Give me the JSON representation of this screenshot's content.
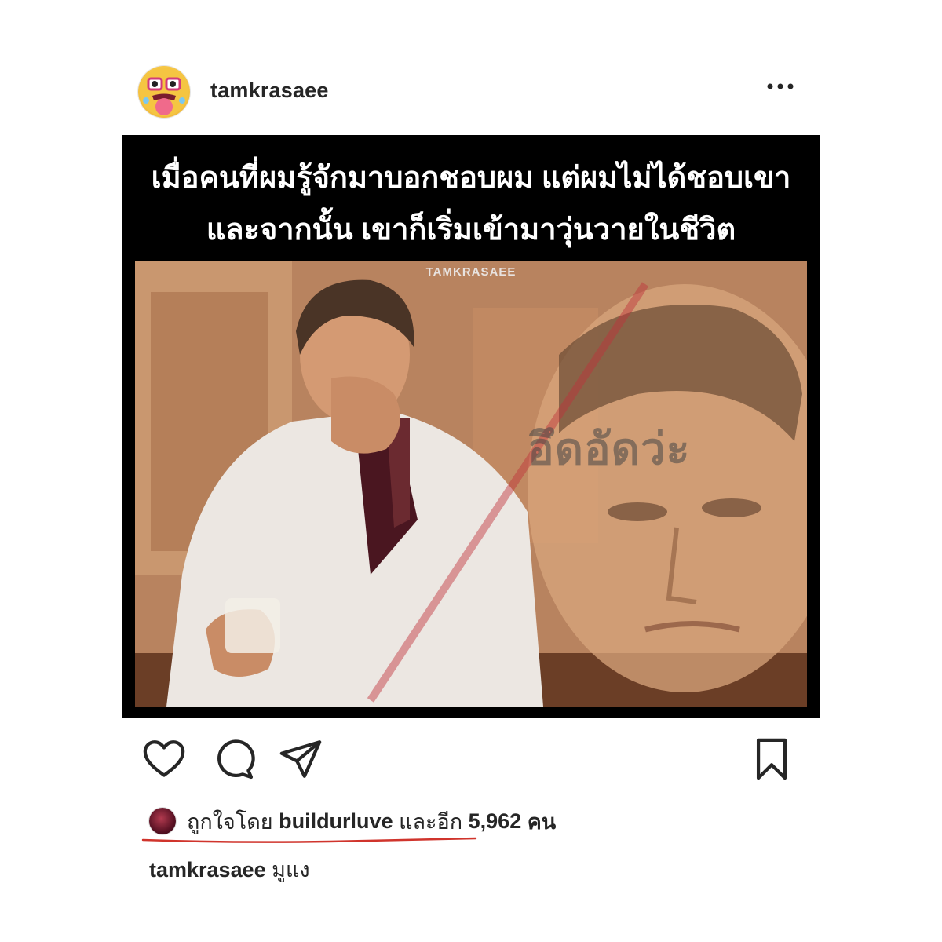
{
  "post_header": {
    "username": "tamkrasaee",
    "avatar_icon": "cartoon-face-avatar",
    "more_icon": "more-horizontal-icon"
  },
  "post_image": {
    "caption_line_1": "เมื่อคนที่ผมรู้จักมาบอกชอบผม แต่ผมไม่ได้ชอบเขา",
    "caption_line_2": "และจากนั้น เขาก็เริ่มเข้ามาวุ่นวายในชีวิต",
    "watermark": "TAMKRASAEE",
    "stamp_text": "อึดอัดว่ะ"
  },
  "actions": {
    "like_icon": "heart-icon",
    "comment_icon": "comment-icon",
    "share_icon": "send-icon",
    "save_icon": "bookmark-icon"
  },
  "likes": {
    "prefix": "ถูกใจโดย",
    "liked_by": "buildurluve",
    "and_more": "และอีก",
    "count": "5,962",
    "suffix": "คน",
    "underline_color": "#d0342c"
  },
  "caption": {
    "username": "tamkrasaee",
    "text": "มูแง"
  }
}
